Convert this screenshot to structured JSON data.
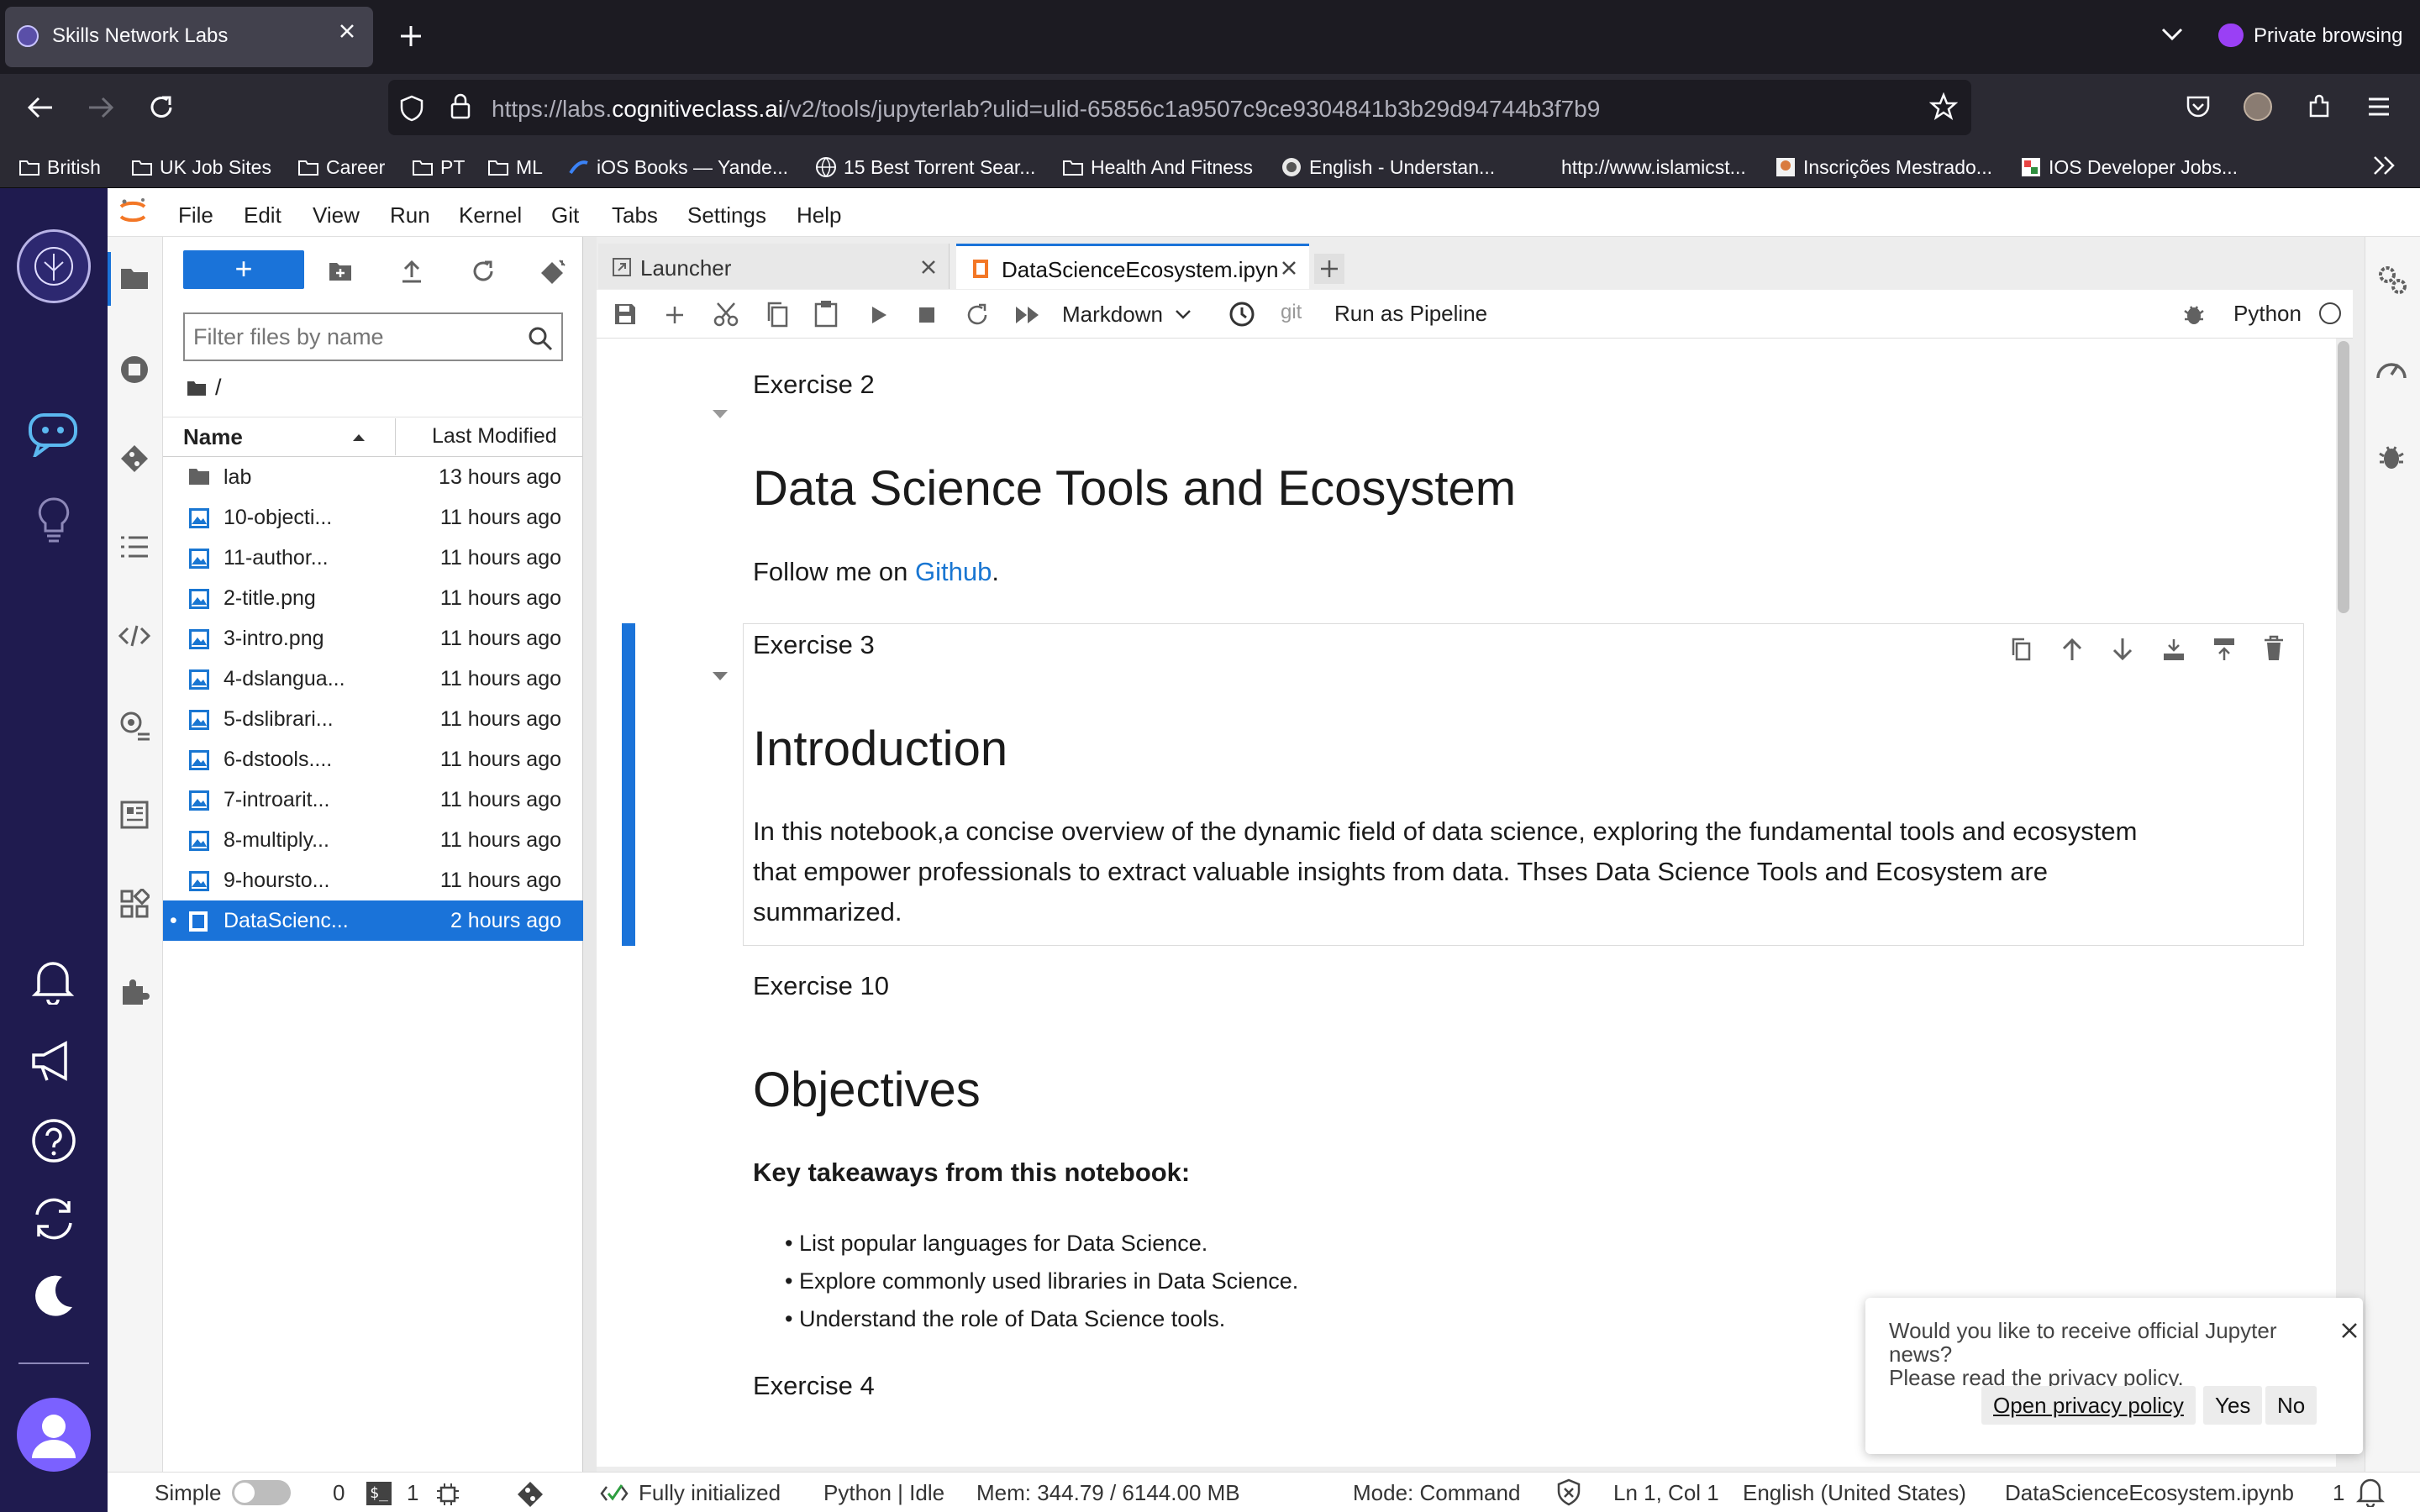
{
  "browser": {
    "tab_title": "Skills Network Labs",
    "private_label": "Private browsing",
    "url_prefix": "https://labs.",
    "url_host": "cognitiveclass.ai",
    "url_path": "/v2/tools/jupyterlab?ulid=ulid-65856c1a9507c9ce9304841b3b29d94744b3f7b9",
    "bookmarks": [
      "British",
      "UK Job Sites",
      "Career",
      "PT",
      "ML",
      "iOS Books — Yande...",
      "15 Best Torrent Sear...",
      "Health And Fitness",
      "English - Understan...",
      "http://www.islamicst...",
      "Inscrições Mestrado...",
      "IOS Developer Jobs..."
    ]
  },
  "menu": [
    "File",
    "Edit",
    "View",
    "Run",
    "Kernel",
    "Git",
    "Tabs",
    "Settings",
    "Help"
  ],
  "filebrowser": {
    "new_label": "+",
    "filter_placeholder": "Filter files by name",
    "path": "/",
    "col_name": "Name",
    "col_modified": "Last Modified",
    "files": [
      {
        "name": "lab",
        "modified": "13 hours ago",
        "type": "folder"
      },
      {
        "name": "10-objecti...",
        "modified": "11 hours ago",
        "type": "image"
      },
      {
        "name": "11-author...",
        "modified": "11 hours ago",
        "type": "image"
      },
      {
        "name": "2-title.png",
        "modified": "11 hours ago",
        "type": "image"
      },
      {
        "name": "3-intro.png",
        "modified": "11 hours ago",
        "type": "image"
      },
      {
        "name": "4-dslangua...",
        "modified": "11 hours ago",
        "type": "image"
      },
      {
        "name": "5-dslibrari...",
        "modified": "11 hours ago",
        "type": "image"
      },
      {
        "name": "6-dstools....",
        "modified": "11 hours ago",
        "type": "image"
      },
      {
        "name": "7-introarit...",
        "modified": "11 hours ago",
        "type": "image"
      },
      {
        "name": "8-multiply...",
        "modified": "11 hours ago",
        "type": "image"
      },
      {
        "name": "9-hoursto...",
        "modified": "11 hours ago",
        "type": "image"
      },
      {
        "name": "DataScienc...",
        "modified": "2 hours ago",
        "type": "notebook",
        "selected": true
      }
    ]
  },
  "tabs": [
    {
      "label": "Launcher",
      "active": false
    },
    {
      "label": "DataScienceEcosystem.ipyn",
      "active": true
    }
  ],
  "nbtoolbar": {
    "cell_type": "Markdown",
    "git": "git",
    "pipeline": "Run as Pipeline",
    "kernel": "Python"
  },
  "notebook": {
    "ex2": "Exercise 2",
    "title": "Data Science Tools and Ecosystem",
    "follow_prefix": "Follow me on ",
    "follow_link": "Github",
    "follow_suffix": ".",
    "ex3": "Exercise 3",
    "intro_heading": "Introduction",
    "intro_line1": "In this notebook,a concise overview of the dynamic field of data science, exploring the fundamental tools and ecosystem",
    "intro_line2": "that empower professionals to extract valuable insights from data. Thses Data Science Tools and Ecosystem are",
    "intro_line3": "summarized.",
    "ex10": "Exercise 10",
    "objectives_heading": "Objectives",
    "takeaways": "Key takeaways from this notebook:",
    "bullets": [
      "List popular languages for Data Science.",
      "Explore commonly used libraries in Data Science.",
      "Understand the role of Data Science tools."
    ],
    "ex4": "Exercise 4"
  },
  "popup": {
    "line1": "Would you like to receive official Jupyter news?",
    "line2": "Please read the privacy policy.",
    "open_policy": "Open privacy policy",
    "yes": "Yes",
    "no": "No"
  },
  "status": {
    "mode_label": "Simple",
    "terminals": "0",
    "kernels": "1",
    "initialized": "Fully initialized",
    "kernel_state": "Python | Idle",
    "memory": "Mem: 344.79 / 6144.00 MB",
    "cmd_mode": "Mode: Command",
    "position": "Ln 1, Col 1",
    "language": "English (United States)",
    "filename": "DataScienceEcosystem.ipynb",
    "notifications": "1"
  },
  "colors": {
    "accent": "#1a73d9",
    "sidebar": "#1f1b4f",
    "link": "#1976d2"
  }
}
